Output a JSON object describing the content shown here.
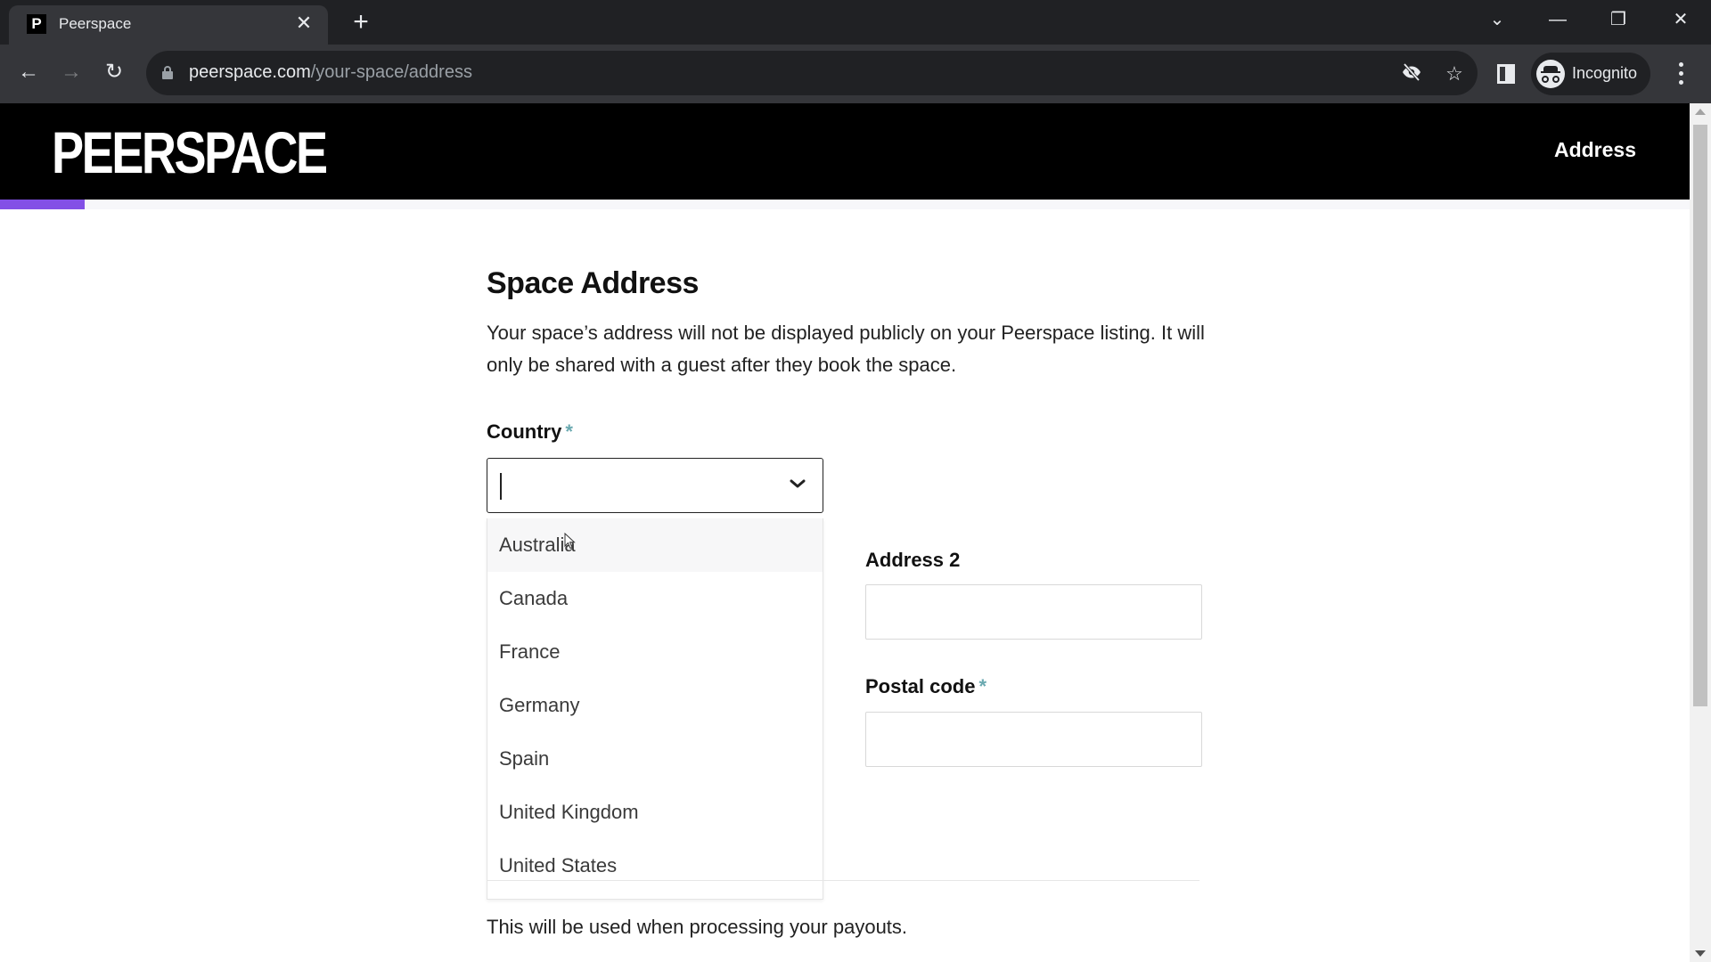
{
  "browser": {
    "tab": {
      "title": "Peerspace",
      "favicon_letter": "P",
      "close_glyph": "✕"
    },
    "new_tab_glyph": "+",
    "window_controls": {
      "tab_search": "⌄",
      "minimize": "—",
      "restore": "❐",
      "close": "✕"
    },
    "nav": {
      "back": "←",
      "forward": "→",
      "reload": "↻"
    },
    "url": {
      "domain": "peerspace.com",
      "path": "/your-space/address"
    },
    "omnibox_icons": {
      "tracking_protection": "eye-off",
      "bookmark": "☆"
    },
    "profile": {
      "label": "Incognito"
    }
  },
  "header": {
    "logo": "PEERSPACE",
    "step_title": "Address",
    "progress_percent": 5
  },
  "main": {
    "title": "Space Address",
    "description": "Your space’s address will not be displayed publicly on your Peerspace listing. It will only be shared with a guest after they book the space.",
    "country": {
      "label": "Country",
      "required_mark": "*",
      "value": "",
      "options": [
        "Australia",
        "Canada",
        "France",
        "Germany",
        "Spain",
        "United Kingdom",
        "United States"
      ],
      "highlighted_option": "Australia"
    },
    "address2": {
      "label": "Address 2",
      "value": ""
    },
    "postal_code": {
      "label": "Postal code",
      "required_mark": "*",
      "value": ""
    },
    "payout_note": "This will be used when processing your payouts."
  }
}
